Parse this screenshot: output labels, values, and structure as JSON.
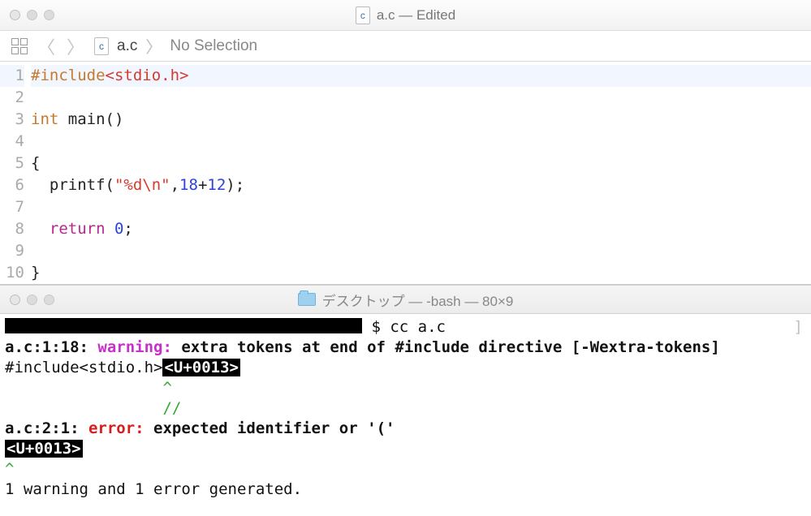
{
  "editor": {
    "title_file": "a.c",
    "title_suffix": "— Edited",
    "file_icon_letter": "c",
    "breadcrumb": {
      "file": "a.c",
      "selection": "No Selection",
      "sep": "〉"
    },
    "code": {
      "lines": [
        "1",
        "2",
        "3",
        "4",
        "5",
        "6",
        "7",
        "8",
        "9",
        "10"
      ],
      "l1_include": "#include",
      "l1_angle": "<stdio.h>",
      "l3_type": "int",
      "l3_main": " main()",
      "l5_brace": "{",
      "l6_pre": "  printf(",
      "l6_str": "\"%d\\n\"",
      "l6_comma": ",",
      "l6_n1": "18",
      "l6_plus": "+",
      "l6_n2": "12",
      "l6_end": ");",
      "l8_ret": "return",
      "l8_zero": " 0",
      "l8_semi": ";",
      "l10_brace": "}"
    }
  },
  "terminal": {
    "title": "デスクトップ — -bash — 80×9",
    "prompt_cmd_prefix": "$ ",
    "cmd": "cc a.c",
    "warn_loc": "a.c:1:18: ",
    "warn_word": "warning: ",
    "warn_msg": "extra tokens at end of #include directive [-Wextra-tokens]",
    "ctx_include": "#include<stdio.h>",
    "unicode_box": "<U+0013>",
    "slashes": "//",
    "caret": "^",
    "err_loc": "a.c:2:1: ",
    "err_word": "error: ",
    "err_msg": "expected identifier or '('",
    "summary": "1 warning and 1 error generated."
  }
}
